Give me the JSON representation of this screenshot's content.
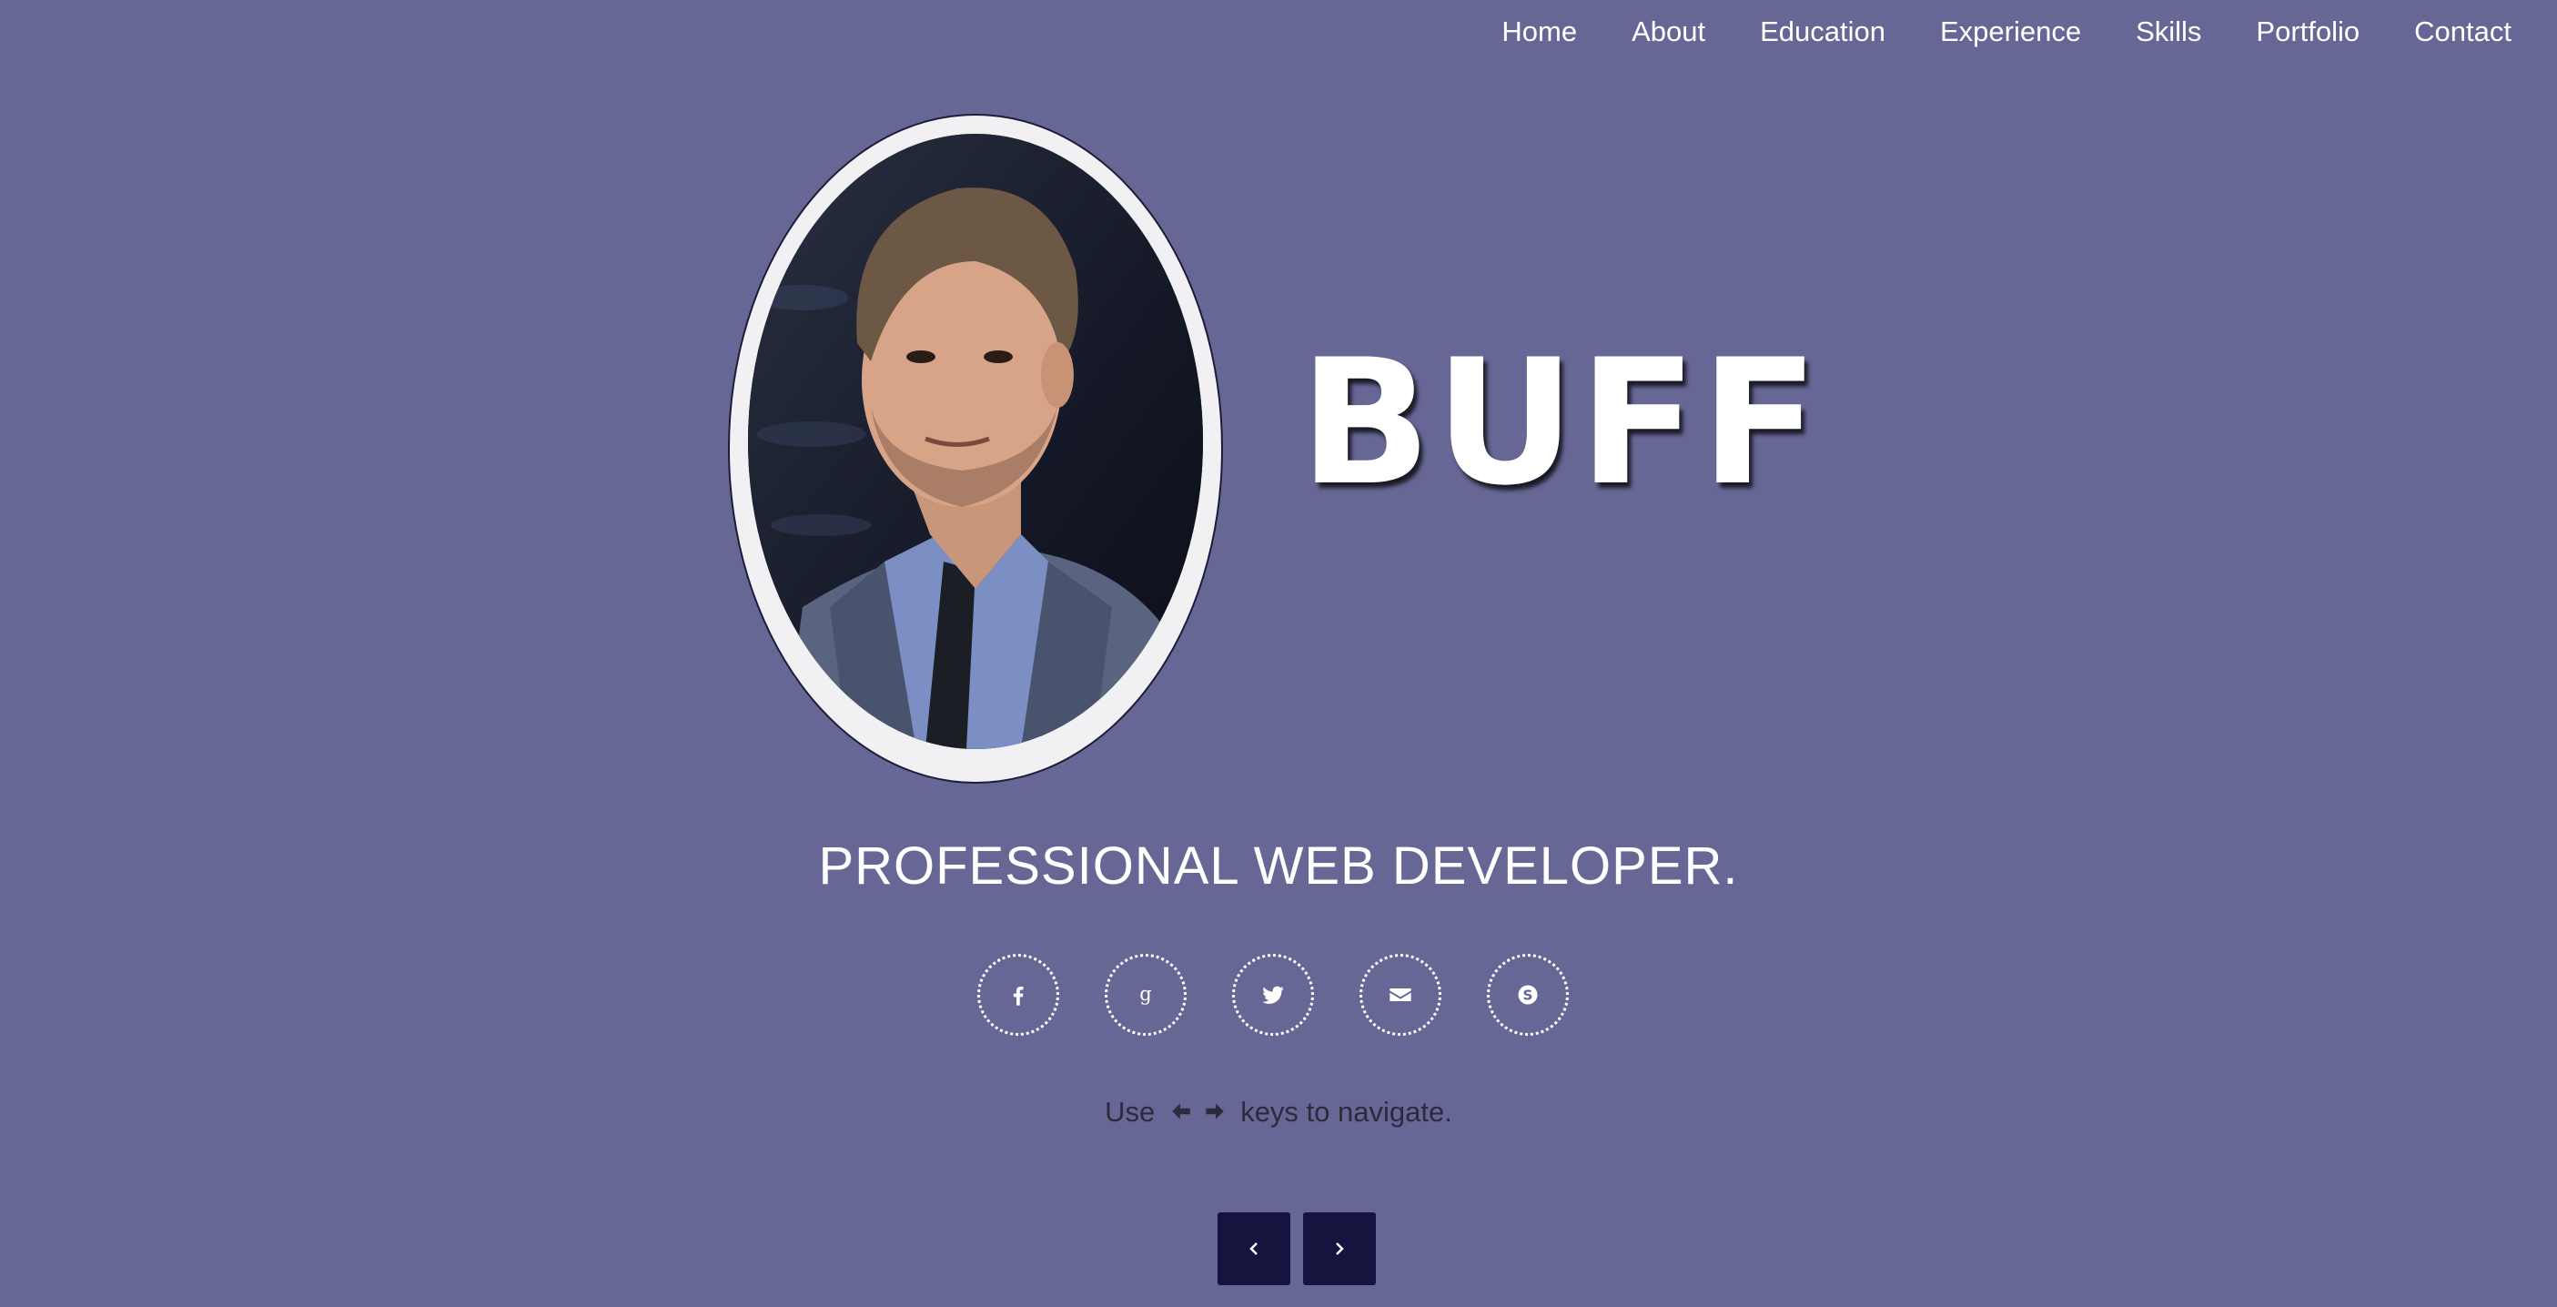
{
  "nav": {
    "items": [
      {
        "label": "Home"
      },
      {
        "label": "About"
      },
      {
        "label": "Education"
      },
      {
        "label": "Experience"
      },
      {
        "label": "Skills"
      },
      {
        "label": "Portfolio"
      },
      {
        "label": "Contact"
      }
    ]
  },
  "hero": {
    "logo_text": "BUFF",
    "tagline": "PROFESSIONAL WEB DEVELOPER.",
    "portrait_icon": "portrait-photo"
  },
  "socials": [
    {
      "icon": "facebook-icon"
    },
    {
      "icon": "google-icon"
    },
    {
      "icon": "twitter-icon"
    },
    {
      "icon": "email-icon"
    },
    {
      "icon": "skype-icon"
    }
  ],
  "hint": {
    "prefix": "Use",
    "suffix": "keys to navigate.",
    "icons": [
      "arrow-left-icon",
      "arrow-right-icon"
    ]
  },
  "pager": {
    "prev_icon": "chevron-left-icon",
    "next_icon": "chevron-right-icon"
  },
  "colors": {
    "background": "#676796",
    "text": "#ffffff",
    "hint_text": "#2b2b3e",
    "button": "#14143f"
  }
}
